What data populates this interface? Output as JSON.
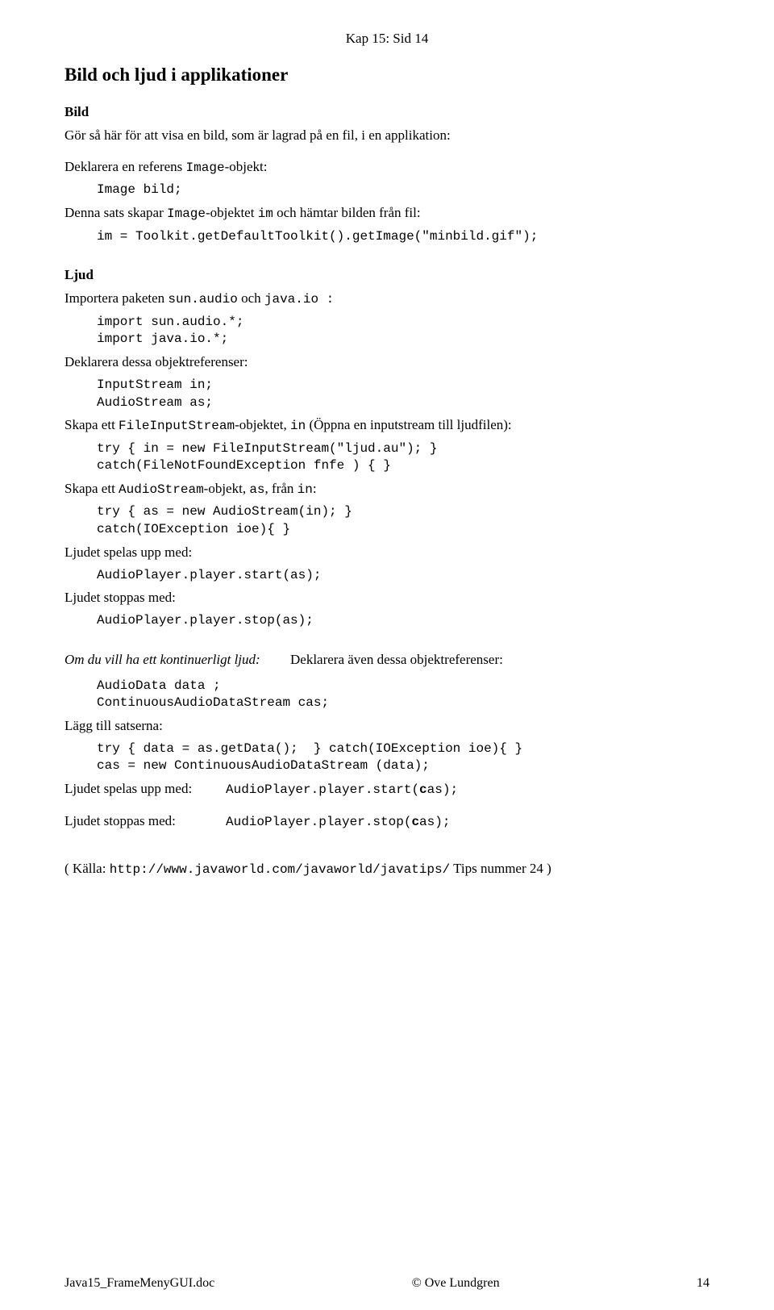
{
  "header": "Kap 15:  Sid 14",
  "title": "Bild och ljud i applikationer",
  "bild": {
    "heading": "Bild",
    "line1": "Gör så här för att visa en bild, som är lagrad på en fil, i en applikation:",
    "line2a": "Deklarera en referens ",
    "line2b": "Image",
    "line2c": "-objekt:",
    "code1": "Image bild;",
    "line3a": "Denna sats skapar ",
    "line3b": "Image",
    "line3c": "-objektet ",
    "line3d": "im",
    "line3e": " och hämtar bilden från fil:",
    "code2": "im = Toolkit.getDefaultToolkit().getImage(\"minbild.gif\");"
  },
  "ljud": {
    "heading": "Ljud",
    "l1a": "Importera paketen ",
    "l1b": "sun.audio",
    "l1c": " och ",
    "l1d": "java.io :",
    "code1": "import sun.audio.*;\nimport java.io.*;",
    "l2": "Deklarera dessa objektreferenser:",
    "code2": "InputStream in;\nAudioStream as;",
    "l3a": "Skapa ett ",
    "l3b": "FileInputStream",
    "l3c": "-objektet, ",
    "l3d": "in",
    "l3e": " (Öppna en inputstream till ljudfilen):",
    "code3": "try { in = new FileInputStream(\"ljud.au\"); }\ncatch(FileNotFoundException fnfe ) { }",
    "l4a": "Skapa ett  ",
    "l4b": "AudioStream",
    "l4c": "-objekt, ",
    "l4d": "as",
    "l4e": ", från ",
    "l4f": "in",
    "l4g": ":",
    "code4": "try { as = new AudioStream(in); }\ncatch(IOException ioe){ }",
    "l5": "Ljudet spelas upp med:",
    "code5": "AudioPlayer.player.start(as);",
    "l6": "Ljudet stoppas med:",
    "code6": "AudioPlayer.player.stop(as);"
  },
  "cont": {
    "l1a": "Om du vill ha ett kontinuerligt ljud:",
    "l1b": "Deklarera även dessa objektreferenser:",
    "code1": "AudioData data ;\nContinuousAudioDataStream cas;",
    "l2": "Lägg till satserna:",
    "code2": "try { data = as.getData();  } catch(IOException ioe){ }\ncas = new ContinuousAudioDataStream (data);",
    "l3": "Ljudet spelas upp med:",
    "code3": "AudioPlayer.player.start(cas);",
    "l4": "Ljudet stoppas med:",
    "code4": "AudioPlayer.player.stop(cas);"
  },
  "source": {
    "pre": "( Källa:  ",
    "url": "http://www.javaworld.com/javaworld/javatips/",
    "post": "   Tips nummer 24  )"
  },
  "footer": {
    "left": "Java15_FrameMenyGUI.doc",
    "center": "© Ove Lundgren",
    "right": "14"
  }
}
